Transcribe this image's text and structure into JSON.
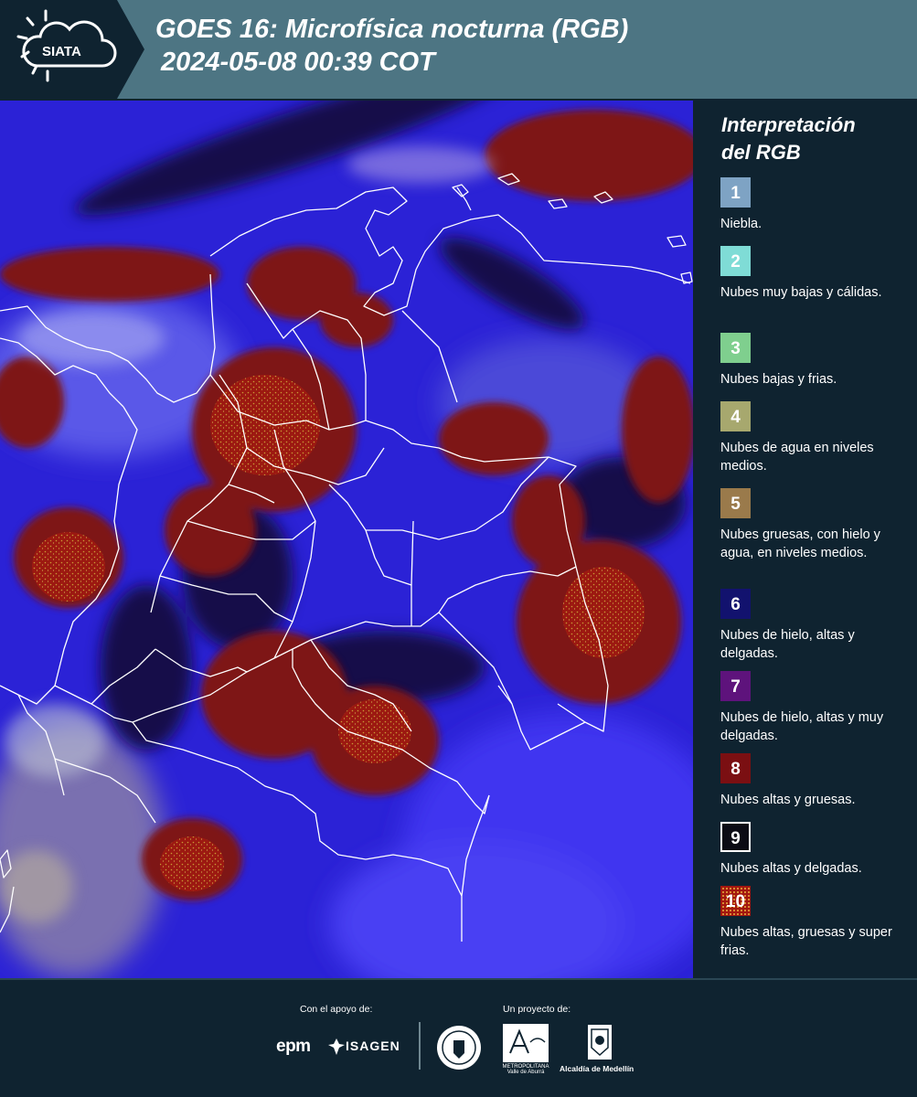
{
  "header": {
    "logo_text": "SIATA",
    "title_line1": "GOES 16: Microfísica nocturna (RGB)",
    "title_line2": "2024-05-08 00:39 COT"
  },
  "legend": {
    "title_line1": "Interpretación",
    "title_line2": "del RGB",
    "items": [
      {
        "number": "1",
        "color": "#7ea3c4",
        "label": "Niebla."
      },
      {
        "number": "2",
        "color": "#7fdcd6",
        "label": "Nubes muy bajas y cálidas."
      },
      {
        "number": "3",
        "color": "#7fcf8e",
        "label": "Nubes bajas y frias."
      },
      {
        "number": "4",
        "color": "#a7a86e",
        "label": "Nubes de agua en niveles medios."
      },
      {
        "number": "5",
        "color": "#9a7a4b",
        "label": "Nubes gruesas, con hielo y agua, en niveles medios."
      },
      {
        "number": "6",
        "color": "#12126e",
        "label": "Nubes de hielo, altas y delgadas."
      },
      {
        "number": "7",
        "color": "#5e137c",
        "label": "Nubes de hielo, altas y muy delgadas."
      },
      {
        "number": "8",
        "color": "#7b0f12",
        "label": "Nubes altas y gruesas."
      },
      {
        "number": "9",
        "color": "#0b0b14",
        "label": "Nubes altas y delgadas."
      },
      {
        "number": "10",
        "color": "#a3170f",
        "label": "Nubes altas, gruesas y super frias."
      }
    ]
  },
  "footer": {
    "support_label": "Con el apoyo de:",
    "project_label": "Un proyecto de:",
    "sponsor_1": "epm",
    "sponsor_2": "ISAGEN",
    "partner_1": "METROPOLITANA Valle de Aburrá",
    "partner_2": "Alcaldía de Medellín"
  }
}
